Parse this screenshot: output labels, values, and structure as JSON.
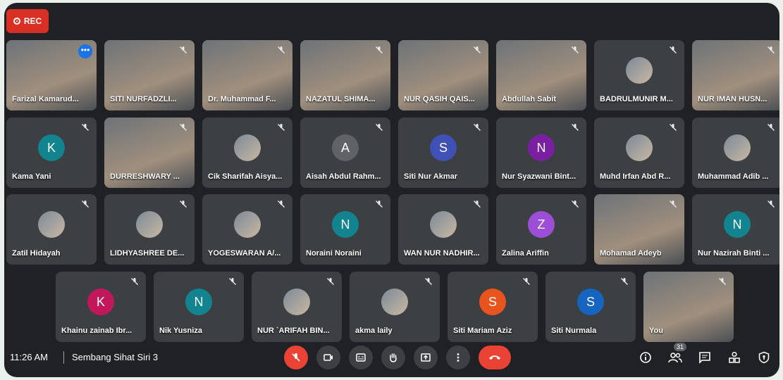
{
  "rec_label": "REC",
  "rows": [
    [
      {
        "name": "Farizal Kamarud...",
        "kind": "video",
        "active": true,
        "more": true
      },
      {
        "name": "SITI NURFADZLI...",
        "kind": "video"
      },
      {
        "name": "Dr. Muhammad F...",
        "kind": "video"
      },
      {
        "name": "NAZATUL SHIMA...",
        "kind": "video"
      },
      {
        "name": "NUR QASIH QAIS...",
        "kind": "video"
      },
      {
        "name": "Abdullah Sabit",
        "kind": "video"
      },
      {
        "name": "BADRULMUNIR M...",
        "kind": "photo"
      },
      {
        "name": "NUR IMAN HUSN...",
        "kind": "video"
      }
    ],
    [
      {
        "name": "Kama Yani",
        "kind": "letter",
        "letter": "K",
        "color": "#12848f"
      },
      {
        "name": "DURRESHWARY ...",
        "kind": "video"
      },
      {
        "name": "Cik Sharifah Aisya...",
        "kind": "photo"
      },
      {
        "name": "Aisah Abdul Rahm...",
        "kind": "letter",
        "letter": "A",
        "color": "#5f6368"
      },
      {
        "name": "Siti Nur Akmar",
        "kind": "letter",
        "letter": "S",
        "color": "#3f51b5"
      },
      {
        "name": "Nur Syazwani Bint...",
        "kind": "letter",
        "letter": "N",
        "color": "#7b1fa2"
      },
      {
        "name": "Muhd Irfan Abd R...",
        "kind": "photo"
      },
      {
        "name": "Muhammad Adib ...",
        "kind": "photo"
      }
    ],
    [
      {
        "name": "Zatil Hidayah",
        "kind": "photo"
      },
      {
        "name": "LIDHYASHREE DE...",
        "kind": "photo"
      },
      {
        "name": "YOGESWARAN A/...",
        "kind": "photo"
      },
      {
        "name": "Noraini Noraini",
        "kind": "letter",
        "letter": "N",
        "color": "#12848f"
      },
      {
        "name": "WAN NUR NADHIR...",
        "kind": "photo"
      },
      {
        "name": "Zalina Ariffin",
        "kind": "letter",
        "letter": "Z",
        "color": "#9c4fd6"
      },
      {
        "name": "Mohamad Adeyb",
        "kind": "video"
      },
      {
        "name": "Nur Nazirah Binti ...",
        "kind": "letter",
        "letter": "N",
        "color": "#12848f"
      }
    ],
    [
      {
        "name": "Khainu zainab Ibr...",
        "kind": "letter",
        "letter": "K",
        "color": "#c2185b"
      },
      {
        "name": "Nik Yusniza",
        "kind": "letter",
        "letter": "N",
        "color": "#12848f"
      },
      {
        "name": "NUR `ARIFAH BIN...",
        "kind": "photo"
      },
      {
        "name": "akma laily",
        "kind": "photo"
      },
      {
        "name": "Siti Mariam Aziz",
        "kind": "letter",
        "letter": "S",
        "color": "#e8541e"
      },
      {
        "name": "Siti Nurmala",
        "kind": "letter",
        "letter": "S",
        "color": "#1565c0"
      },
      {
        "name": "You",
        "kind": "video"
      }
    ]
  ],
  "bottom": {
    "time": "11:26 AM",
    "meeting": "Sembang Sihat Siri 3",
    "participants_count": "31"
  },
  "icons": {
    "mute": "mic-off-icon",
    "camera": "camera-icon",
    "captions": "captions-icon",
    "hand": "raise-hand-icon",
    "present": "present-icon",
    "more": "more-options-icon",
    "end": "end-call-icon",
    "info": "info-icon",
    "people": "people-icon",
    "chat": "chat-icon",
    "activities": "activities-icon",
    "host": "host-controls-icon"
  }
}
